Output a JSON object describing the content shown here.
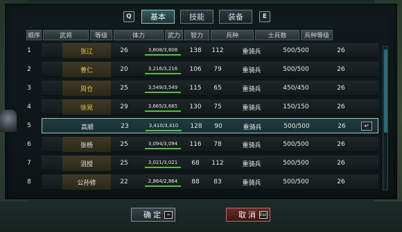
{
  "tabs": [
    {
      "label": "基本",
      "active": true
    },
    {
      "label": "技能",
      "active": false
    },
    {
      "label": "装备",
      "active": false
    }
  ],
  "keys": {
    "prev": "Q",
    "next": "E"
  },
  "columns": [
    "顺序",
    "武将",
    "等级",
    "体力",
    "武力",
    "智力",
    "兵种",
    "士兵数",
    "兵种等级"
  ],
  "rows": [
    {
      "order": "1",
      "name": "张辽",
      "level": "26",
      "hp": "3,608/3,608",
      "war": "138",
      "int": "112",
      "unit": "重骑兵",
      "soldiers": "500/500",
      "unit_level": "26",
      "gold": true
    },
    {
      "order": "2",
      "name": "曹仁",
      "level": "20",
      "hp": "3,216/3,216",
      "war": "106",
      "int": "79",
      "unit": "重骑兵",
      "soldiers": "500/500",
      "unit_level": "26",
      "gold": true
    },
    {
      "order": "3",
      "name": "周仓",
      "level": "25",
      "hp": "3,549/3,549",
      "war": "115",
      "int": "65",
      "unit": "重骑兵",
      "soldiers": "450/450",
      "unit_level": "26",
      "gold": true
    },
    {
      "order": "4",
      "name": "徐晃",
      "level": "29",
      "hp": "3,665/3,665",
      "war": "130",
      "int": "75",
      "unit": "重骑兵",
      "soldiers": "150/150",
      "unit_level": "26",
      "gold": true
    },
    {
      "order": "5",
      "name": "高顺",
      "level": "23",
      "hp": "3,410/3,410",
      "war": "128",
      "int": "90",
      "unit": "重骑兵",
      "soldiers": "500/500",
      "unit_level": "26",
      "gold": false,
      "selected": true
    },
    {
      "order": "6",
      "name": "张杨",
      "level": "25",
      "hp": "3,094/3,094",
      "war": "116",
      "int": "78",
      "unit": "重骑兵",
      "soldiers": "500/500",
      "unit_level": "26",
      "gold": false
    },
    {
      "order": "7",
      "name": "沮授",
      "level": "25",
      "hp": "3,021/3,021",
      "war": "68",
      "int": "112",
      "unit": "重骑兵",
      "soldiers": "500/500",
      "unit_level": "26",
      "gold": false
    },
    {
      "order": "8",
      "name": "公孙修",
      "level": "22",
      "hp": "2,864/2,864",
      "war": "88",
      "int": "83",
      "unit": "重骑兵",
      "soldiers": "500/500",
      "unit_level": "26",
      "gold": false
    }
  ],
  "buttons": {
    "ok": "确定",
    "cancel": "取消",
    "cancel_key": "Esc"
  },
  "colors": {
    "gold_name": "#e8c44a",
    "hp_bar": "#55c044",
    "accent": "#9cc6c8"
  }
}
